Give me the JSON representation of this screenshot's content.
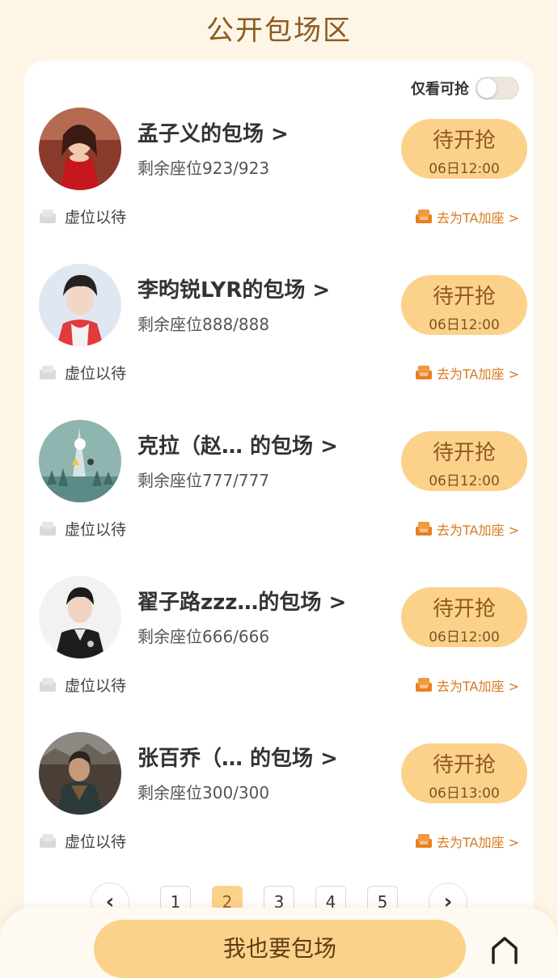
{
  "page": {
    "title": "公开包场区"
  },
  "filter": {
    "label": "仅看可抢",
    "enabled": false
  },
  "rows": [
    {
      "name": "孟子义的包场 >",
      "seats": "剩余座位923/923",
      "button": "待开抢",
      "time": "06日12:00",
      "wait_label": "虚位以待",
      "join_label": "去为TA加座 >"
    },
    {
      "name": "李昀锐LYR的包场 >",
      "seats": "剩余座位888/888",
      "button": "待开抢",
      "time": "06日12:00",
      "wait_label": "虚位以待",
      "join_label": "去为TA加座 >"
    },
    {
      "name": "克拉（赵… 的包场 >",
      "seats": "剩余座位777/777",
      "button": "待开抢",
      "time": "06日12:00",
      "wait_label": "虚位以待",
      "join_label": "去为TA加座 >"
    },
    {
      "name": "翟子路zzz…的包场 >",
      "seats": "剩余座位666/666",
      "button": "待开抢",
      "time": "06日12:00",
      "wait_label": "虚位以待",
      "join_label": "去为TA加座 >"
    },
    {
      "name": "张百乔（… 的包场 >",
      "seats": "剩余座位300/300",
      "button": "待开抢",
      "time": "06日13:00",
      "wait_label": "虚位以待",
      "join_label": "去为TA加座 >"
    }
  ],
  "pagination": {
    "prev": "‹",
    "next": "›",
    "pages": [
      "1",
      "2",
      "3",
      "4",
      "5"
    ],
    "current_page": "2"
  },
  "bottom": {
    "button_label": "我也要包场",
    "icon": "home-icon"
  },
  "colors": {
    "accent": "#fcd28a",
    "title": "#8b5a22",
    "link": "#d77a1e",
    "background": "#fdf6e6"
  }
}
